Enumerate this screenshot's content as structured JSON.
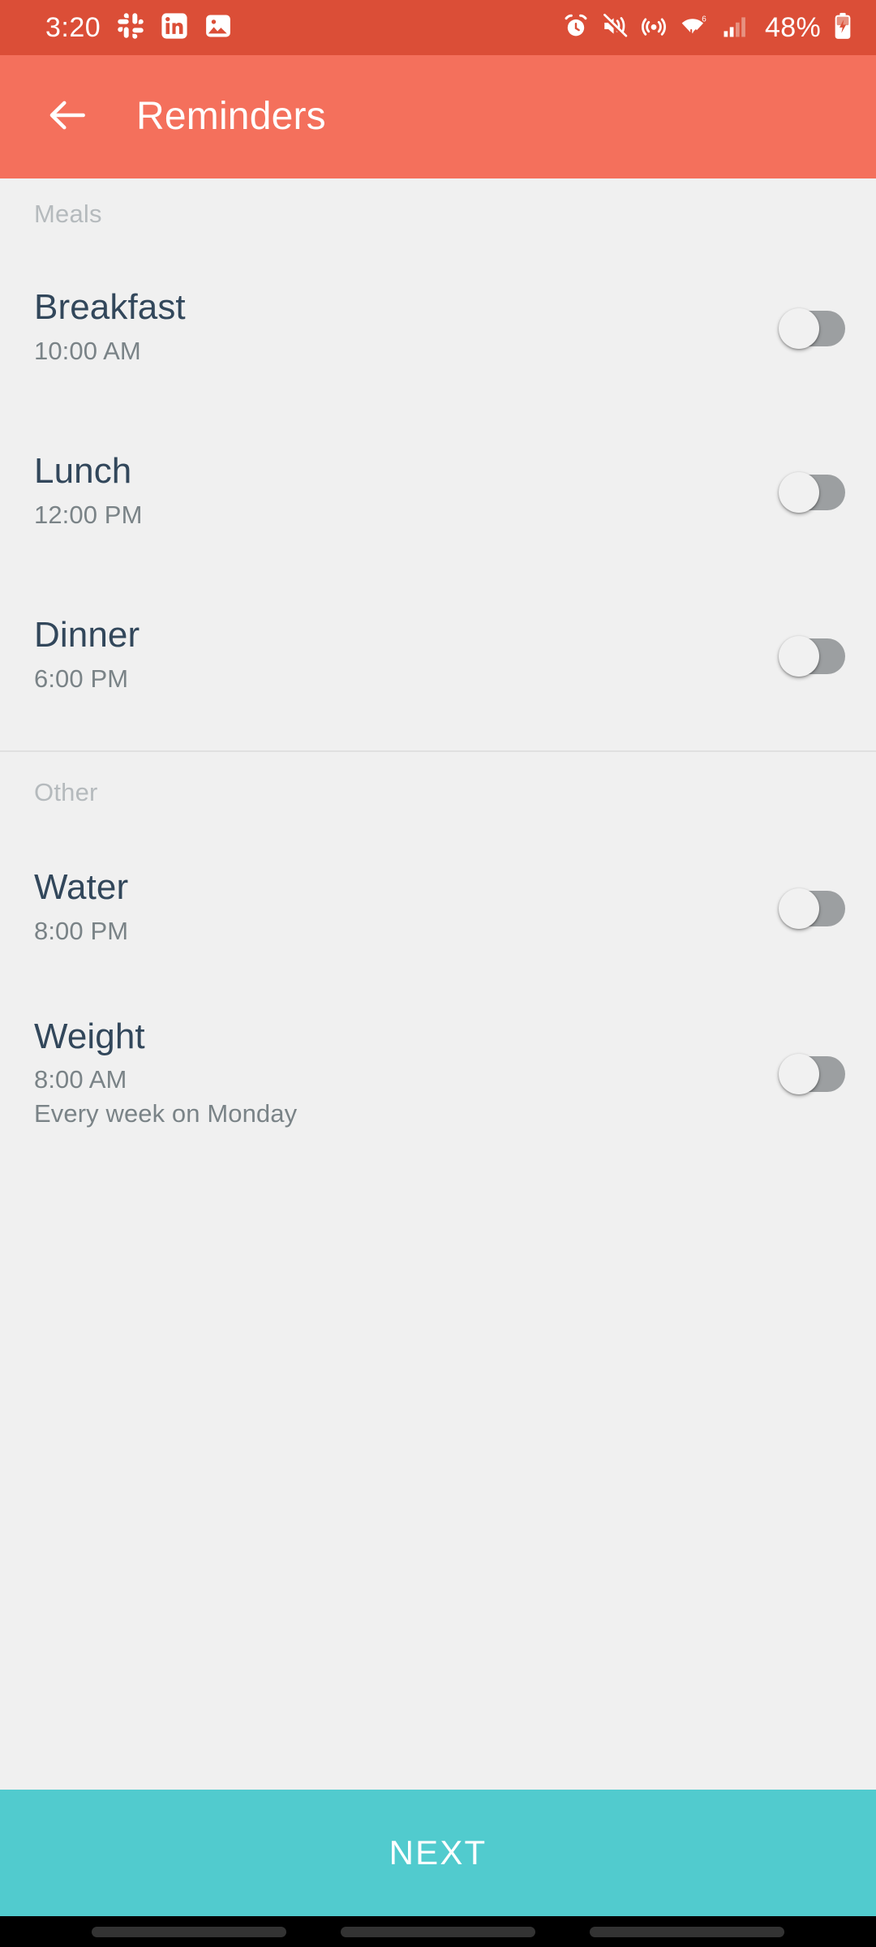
{
  "status_bar": {
    "time": "3:20",
    "battery_percent": "48%",
    "left_icons": [
      "slack-icon",
      "linkedin-icon",
      "photo-icon"
    ],
    "right_icons": [
      "alarm-icon",
      "vibrate-off-icon",
      "hotspot-icon",
      "wifi-6-icon",
      "cellular-signal-icon",
      "battery-charging-icon"
    ],
    "background_color": "#DB4E37"
  },
  "app_bar": {
    "title": "Reminders",
    "back_icon": "arrow-left-icon",
    "background_color": "#F4705C"
  },
  "sections": [
    {
      "header": "Meals",
      "items": [
        {
          "title": "Breakfast",
          "time": "10:00 AM",
          "repeat": "",
          "enabled": false
        },
        {
          "title": "Lunch",
          "time": "12:00 PM",
          "repeat": "",
          "enabled": false
        },
        {
          "title": "Dinner",
          "time": "6:00 PM",
          "repeat": "",
          "enabled": false
        }
      ]
    },
    {
      "header": "Other",
      "items": [
        {
          "title": "Water",
          "time": "8:00 PM",
          "repeat": "",
          "enabled": false
        },
        {
          "title": "Weight",
          "time": "8:00 AM",
          "repeat": "Every week on Monday",
          "enabled": false
        }
      ]
    }
  ],
  "footer": {
    "next_label": "NEXT",
    "next_color": "#51CBCE"
  },
  "nav_bar": {
    "buttons": [
      "recents-button",
      "home-button",
      "back-button"
    ]
  },
  "colors": {
    "page_background": "#F0F0F0",
    "title_text": "#32475B",
    "subtitle_text": "#7A8387",
    "section_header_text": "#B5BABD",
    "switch_track_off": "#9C9FA1",
    "switch_thumb": "#F1F1F1",
    "divider": "#E0E0E0"
  }
}
